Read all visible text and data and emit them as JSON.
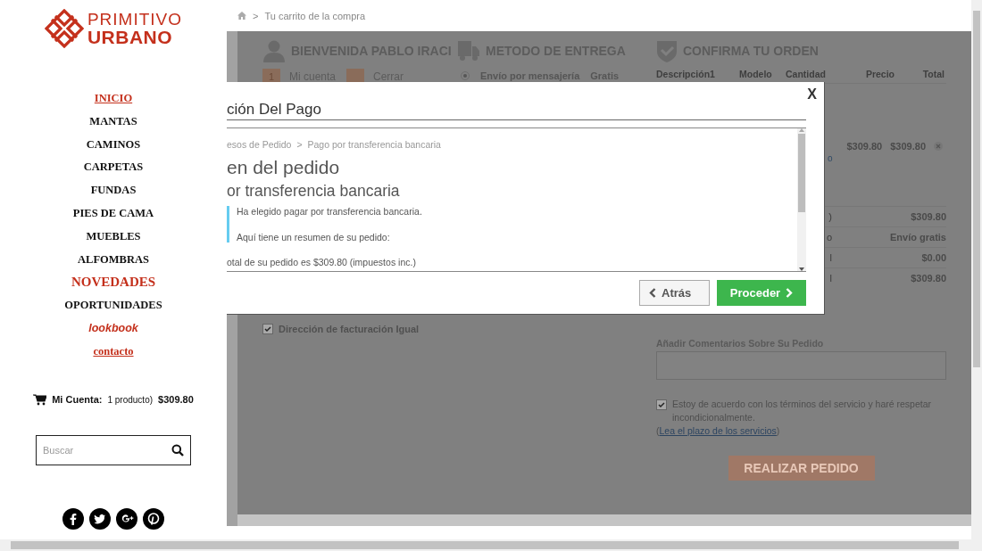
{
  "sidebar": {
    "logo": {
      "line_1": "PRIMITIVO",
      "line_2": "URBANO"
    },
    "nav": [
      {
        "label": "INICIO",
        "kind": "link"
      },
      {
        "label": "MANTAS",
        "kind": "plain"
      },
      {
        "label": "CAMINOS",
        "kind": "plain"
      },
      {
        "label": "CARPETAS",
        "kind": "plain"
      },
      {
        "label": "FUNDAS",
        "kind": "plain"
      },
      {
        "label": "PIES DE CAMA",
        "kind": "plain"
      },
      {
        "label": "MUEBLES",
        "kind": "plain"
      },
      {
        "label": "ALFOMBRAS",
        "kind": "plain"
      },
      {
        "label": "NOVEDADES",
        "kind": "featured"
      },
      {
        "label": "OPORTUNIDADES",
        "kind": "plain"
      },
      {
        "label": "lookbook",
        "kind": "italic"
      },
      {
        "label": "contacto",
        "kind": "link"
      }
    ],
    "cart": {
      "label": "Mi Cuenta:",
      "count": "1 producto)",
      "total": "$309.80"
    },
    "search": {
      "placeholder": "Buscar"
    }
  },
  "breadcrumb": {
    "separator": ">",
    "current": "Tu carrito de la compra"
  },
  "checkout": {
    "account": {
      "title": "BIENVENIDA PABLO IRACI",
      "steps": [
        {
          "badge": "1",
          "label": "Mi cuenta"
        },
        {
          "label": "Cerrar"
        }
      ],
      "billing_same": {
        "label": "Dirección de facturación Igual",
        "checked": true
      }
    },
    "delivery": {
      "title": "METODO DE ENTREGA",
      "option": {
        "label": "Envío por mensajería",
        "price": "Gratis",
        "selected": true
      }
    },
    "order": {
      "title": "CONFIRMA TU ORDEN",
      "columns": [
        "Descripción1",
        "Modelo",
        "Cantidad",
        "Precio",
        "Total"
      ],
      "item": {
        "link_fragment": "o",
        "price": "$309.80",
        "total": "$309.80"
      },
      "totals": [
        {
          "label": ")",
          "value": "$309.80"
        },
        {
          "label": "o",
          "value": "Envío gratis"
        },
        {
          "label": "l",
          "value": "$0.00"
        },
        {
          "label": "l",
          "value": "$309.80"
        }
      ],
      "comments": {
        "label": "Añadir Comentarios Sobre Su Pedido"
      },
      "terms": {
        "checked": true,
        "text": "Estoy de acuerdo con los términos del servicio y haré respetar incondicionalmente.",
        "before": "(",
        "link": "Lea el plazo de los servicios",
        "after": ")"
      },
      "submit": "REALIZAR PEDIDO"
    }
  },
  "modal": {
    "title": "ción Del Pago",
    "close": "X",
    "breadcrumb": [
      "esos de Pedido",
      "Pago por transferencia bancaria"
    ],
    "separator": ">",
    "heading": "en del pedido",
    "subheading": "or transferencia bancaria",
    "notice": [
      "Ha elegido pagar por transferencia bancaria.",
      "Aquí tiene un resumen de su pedido:"
    ],
    "total_line": "otal de su pedido es $309.80 (impuestos inc.)",
    "buttons": [
      {
        "label": "Atrás",
        "kind": "back"
      },
      {
        "label": "Proceder",
        "kind": "proceed"
      }
    ]
  }
}
